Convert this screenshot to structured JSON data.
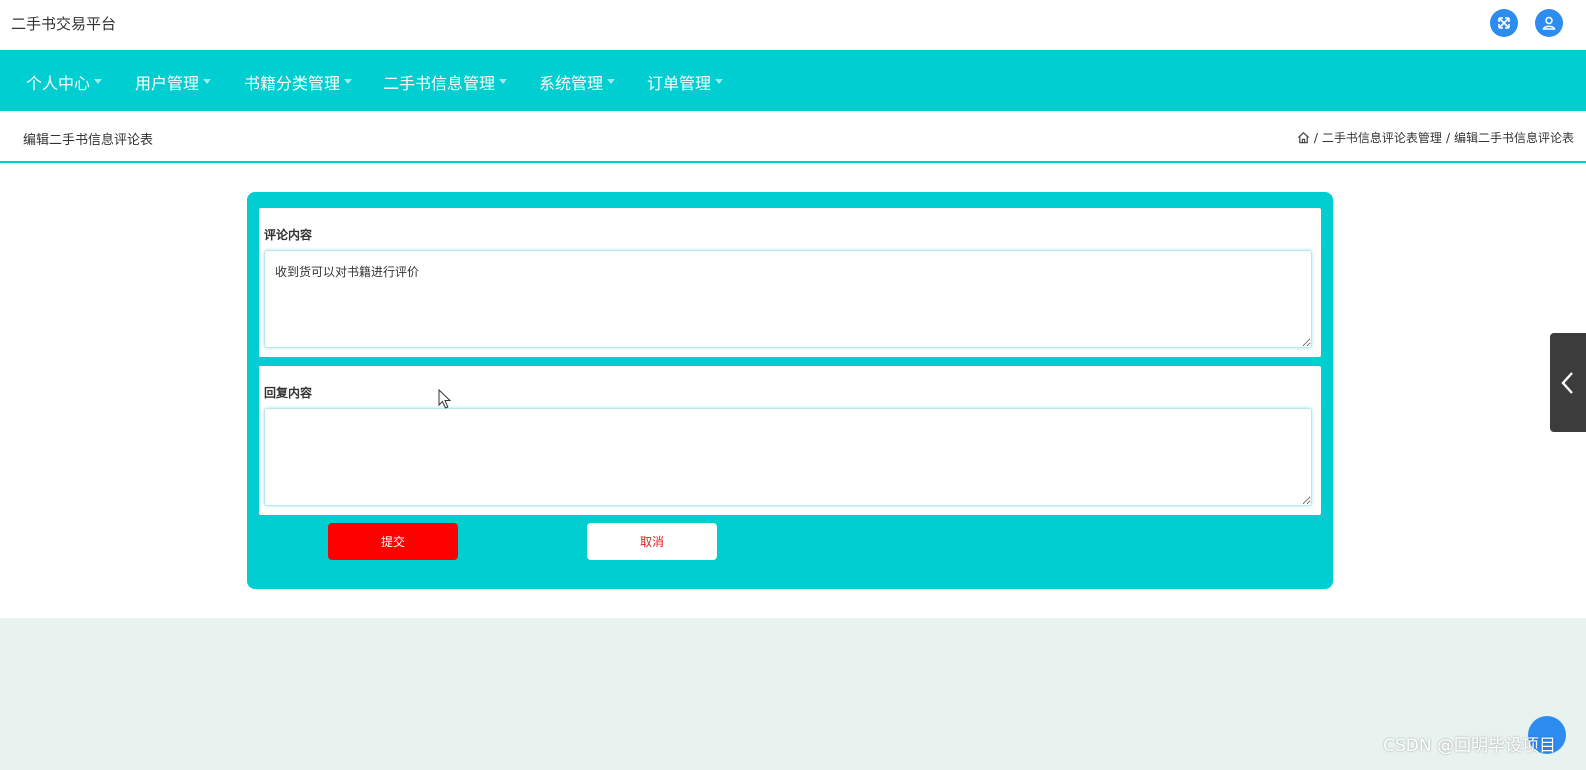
{
  "app": {
    "title": "二手书交易平台"
  },
  "nav": {
    "items": [
      {
        "label": "个人中心"
      },
      {
        "label": "用户管理"
      },
      {
        "label": "书籍分类管理"
      },
      {
        "label": "二手书信息管理"
      },
      {
        "label": "系统管理"
      },
      {
        "label": "订单管理"
      }
    ]
  },
  "page": {
    "title": "编辑二手书信息评论表",
    "breadcrumb": {
      "separator": "/",
      "items": [
        "二手书信息评论表管理",
        "编辑二手书信息评论表"
      ]
    }
  },
  "form": {
    "fields": [
      {
        "label": "评论内容",
        "value": "收到货可以对书籍进行评价"
      },
      {
        "label": "回复内容",
        "value": ""
      }
    ],
    "submit_label": "提交",
    "cancel_label": "取消"
  },
  "watermark": "CSDN @回明毕设项目",
  "colors": {
    "primary": "#00ced1",
    "submit": "#ff0000",
    "icon_button": "#2d8cf0",
    "page_background": "#e8f2ee"
  },
  "icons": {
    "fullscreen": "expand-arrows-icon",
    "user": "user-icon",
    "home": "home-icon",
    "side_tab": "chevron-left-icon"
  }
}
